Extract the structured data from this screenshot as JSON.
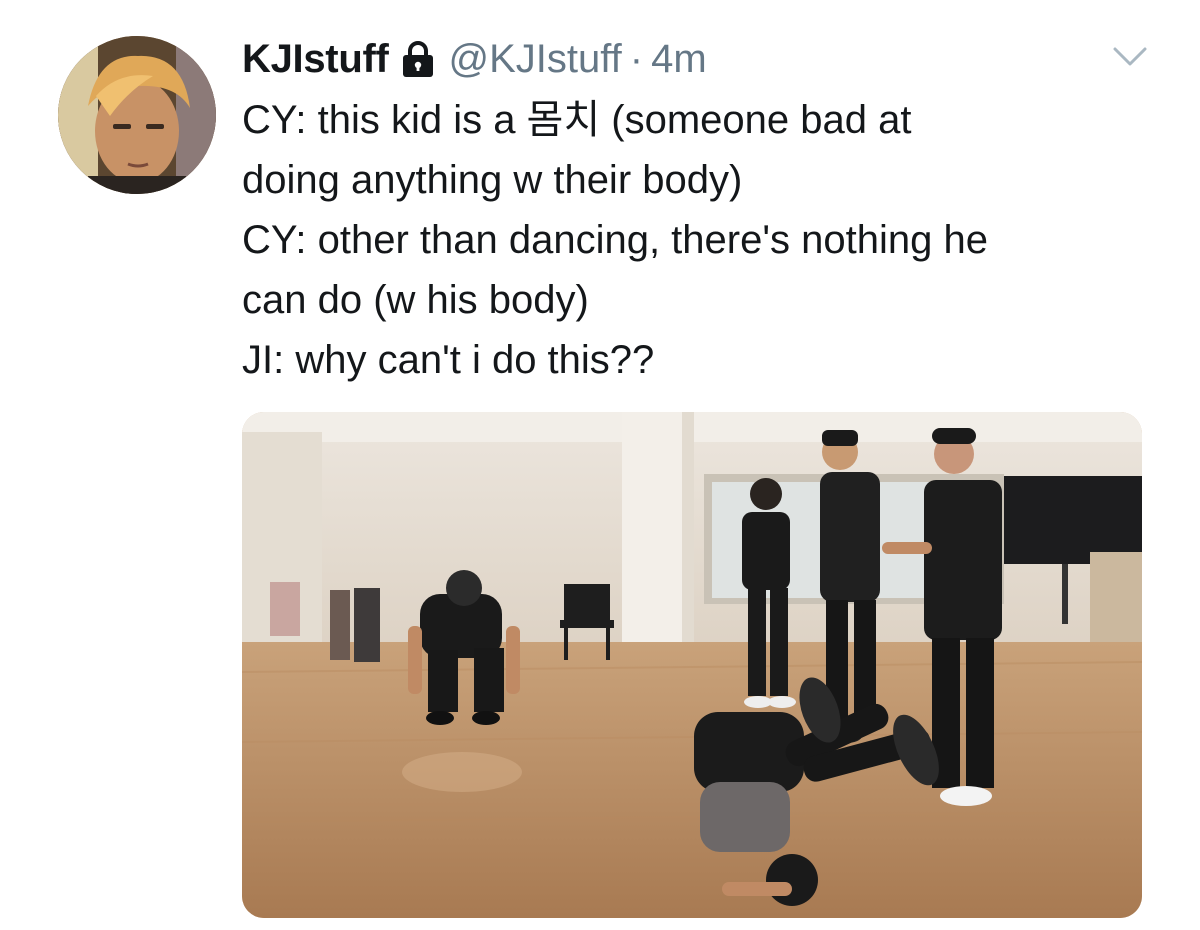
{
  "tweet": {
    "display_name": "KJIstuff",
    "handle": "@KJIstuff",
    "separator": "·",
    "timestamp": "4m",
    "protected": true,
    "lines": [
      "CY: this kid is a 몸치 (someone bad at",
      "doing anything w their body)",
      "CY: other than dancing, there's nothing he",
      "can do (w his body)",
      "JI: why can't i do this??"
    ],
    "media": {
      "type": "video-still",
      "scene": "dance practice room"
    }
  },
  "icons": {
    "lock": "lock-icon",
    "menu": "chevron-down-icon"
  },
  "colors": {
    "text_primary": "#14171a",
    "text_secondary": "#657786",
    "chevron": "#aab8c2"
  }
}
